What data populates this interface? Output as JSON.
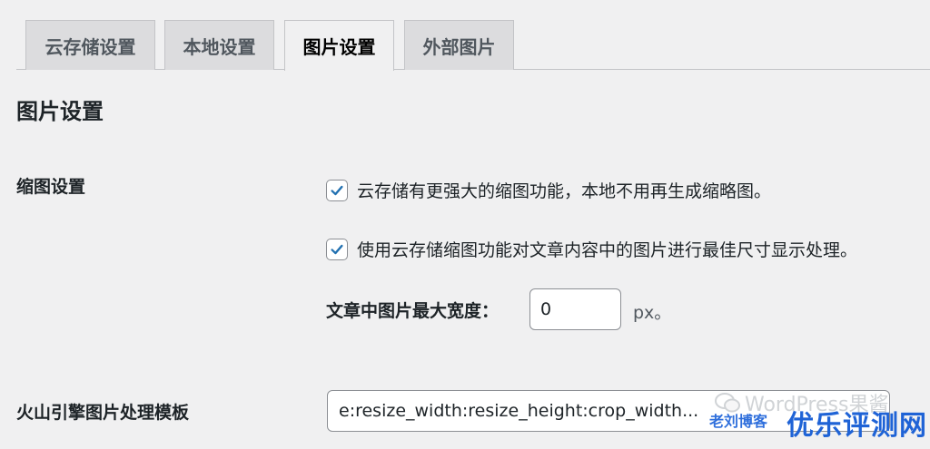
{
  "tabs": [
    {
      "label": "云存储设置",
      "active": false
    },
    {
      "label": "本地设置",
      "active": false
    },
    {
      "label": "图片设置",
      "active": true
    },
    {
      "label": "外部图片",
      "active": false
    }
  ],
  "section_title": "图片设置",
  "thumbnail": {
    "label": "缩图设置",
    "option1": {
      "text": "云存储有更强大的缩图功能，本地不用再生成缩略图。",
      "checked": true
    },
    "option2": {
      "text": "使用云存储缩图功能对文章内容中的图片进行最佳尺寸显示处理。",
      "checked": true
    },
    "max_width_label": "文章中图片最大宽度：",
    "max_width_value": "0",
    "unit": "px。"
  },
  "template": {
    "label": "火山引擎图片处理模板",
    "value": "e:resize_width:resize_height:crop_width..."
  },
  "watermarks": {
    "wechat": "WordPress果酱",
    "blog": "老刘博客",
    "site": "优乐评测网"
  },
  "colors": {
    "checkmark": "#2271b1",
    "page_bg": "#f0f0f1"
  }
}
